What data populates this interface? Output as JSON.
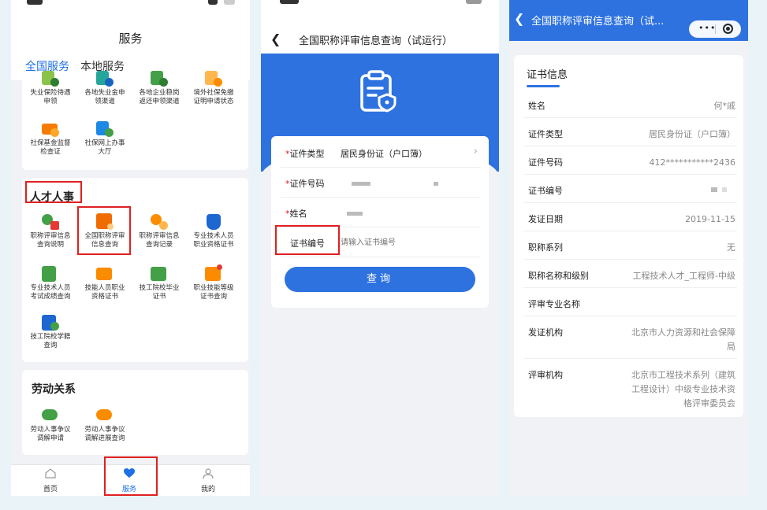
{
  "colors": {
    "primary": "#2e72e0",
    "highlight": "#e02020",
    "background": "#eaf3f8"
  },
  "panel1": {
    "title": "服务",
    "tabs": [
      {
        "label": "全国服务",
        "active": true
      },
      {
        "label": "本地服务",
        "active": false
      }
    ],
    "top_items": [
      {
        "label": "失业保险待遇\n申领",
        "icon": "unemployment-icon"
      },
      {
        "label": "各地失业金申\n领渠道",
        "icon": "unemployment-channel-icon"
      },
      {
        "label": "各地企业稳岗\n返还申领渠道",
        "icon": "job-stabilize-icon"
      },
      {
        "label": "境外社保免缴\n证明申请状态",
        "icon": "overseas-insurance-icon"
      },
      {
        "label": "社保基金监督\n检查证",
        "icon": "fund-supervision-icon"
      },
      {
        "label": "社保网上办事\n大厅",
        "icon": "online-hall-icon"
      }
    ],
    "talent": {
      "title": "人才人事",
      "items": [
        {
          "label": "职称评审信息\n查询说明",
          "icon": "title-review-guide-icon"
        },
        {
          "label": "全国职称评审\n信息查询",
          "icon": "title-review-query-icon"
        },
        {
          "label": "职称评审信息\n查询记录",
          "icon": "title-review-record-icon"
        },
        {
          "label": "专业技术人员\n职业资格证书",
          "icon": "professional-cert-icon"
        },
        {
          "label": "专业技术人员\n考试成绩查询",
          "icon": "exam-score-icon"
        },
        {
          "label": "技能人员职业\n资格证书",
          "icon": "skill-cert-icon"
        },
        {
          "label": "技工院校毕业\n证书",
          "icon": "graduation-cert-icon"
        },
        {
          "label": "职业技能等级\n证书查询",
          "icon": "skill-level-icon"
        },
        {
          "label": "技工院校学籍\n查询",
          "icon": "student-record-icon"
        }
      ]
    },
    "labor": {
      "title": "劳动关系",
      "items": [
        {
          "label": "劳动人事争议\n调解申请",
          "icon": "dispute-apply-icon"
        },
        {
          "label": "劳动人事争议\n调解进展查询",
          "icon": "dispute-progress-icon"
        }
      ]
    },
    "nav": [
      {
        "label": "首页",
        "icon": "home-icon"
      },
      {
        "label": "服务",
        "icon": "heart-icon"
      },
      {
        "label": "我的",
        "icon": "user-icon"
      }
    ]
  },
  "panel2": {
    "title": "全国职称评审信息查询（试运行）",
    "fields": [
      {
        "label": "证件类型",
        "required": true,
        "value": "居民身份证（户口簿）"
      },
      {
        "label": "证件号码",
        "required": true,
        "value": ""
      },
      {
        "label": "姓名",
        "required": true,
        "value": ""
      },
      {
        "label": "证书编号",
        "required": false,
        "placeholder": "请输入证书编号"
      }
    ],
    "button": "查询"
  },
  "panel3": {
    "title": "全国职称评审信息查询（试...",
    "section": "证书信息",
    "rows": [
      {
        "label": "姓名",
        "value": "何*戚"
      },
      {
        "label": "证件类型",
        "value": "居民身份证（户口簿）"
      },
      {
        "label": "证件号码",
        "value": "412***********2436"
      },
      {
        "label": "证书编号",
        "value": ""
      },
      {
        "label": "发证日期",
        "value": "2019-11-15"
      },
      {
        "label": "职称系列",
        "value": "无"
      },
      {
        "label": "职称名称和级别",
        "value": "工程技术人才_工程师-中级"
      },
      {
        "label": "评审专业名称",
        "value": ""
      },
      {
        "label": "发证机构",
        "value": "北京市人力资源和社会保障\n局"
      },
      {
        "label": "评审机构",
        "value": "北京市工程技术系列（建筑\n工程设计）中级专业技术资\n格评审委员会"
      }
    ]
  }
}
